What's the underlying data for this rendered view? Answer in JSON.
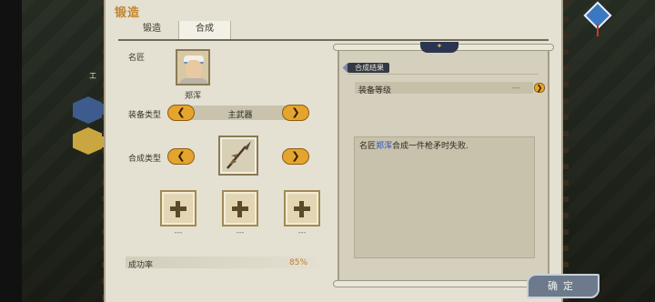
{
  "panel": {
    "title": "锻造",
    "tabs": [
      {
        "label": "锻造",
        "active": false
      },
      {
        "label": "合成",
        "active": true
      }
    ]
  },
  "craftsman": {
    "label": "名匠",
    "name": "郑浑"
  },
  "equipment_type": {
    "label": "装备类型",
    "value": "主武器",
    "prev": "❮",
    "next": "❯"
  },
  "synthesis_type": {
    "label": "合成类型",
    "prev": "❮",
    "next": "❯"
  },
  "material_slots": [
    {
      "caption": "---"
    },
    {
      "caption": "---"
    },
    {
      "caption": "---"
    }
  ],
  "success": {
    "label": "成功率",
    "value": "85%"
  },
  "result": {
    "title": "合成结果",
    "equip_level_label": "装备等级",
    "equip_level_value": "---",
    "level_button": "❯",
    "message_prefix": "名匠",
    "message_name": "郑浑",
    "message_suffix": "合成一件枪矛时失败."
  },
  "confirm_button": "确定",
  "side_label": "工",
  "colors": {
    "accent_gold": "#e5a42d",
    "title_orange": "#c2842f",
    "highlight_blue": "#2a4fc7",
    "success_orange": "#c27a2a"
  }
}
